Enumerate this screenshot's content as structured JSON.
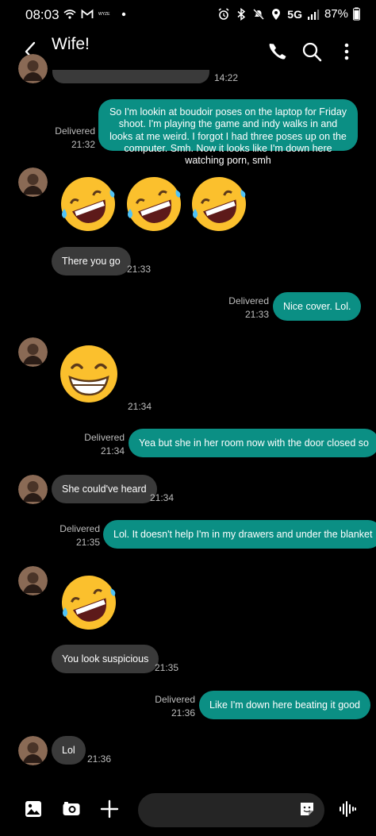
{
  "status_bar": {
    "time": "08:03",
    "network": "5G",
    "battery": "87%",
    "left_icons": [
      "wifi-calling-icon",
      "gmail-icon",
      "wyze-icon",
      "dot-icon"
    ],
    "wyze_label": "WYZE",
    "right_icons": [
      "alarm-icon",
      "bluetooth-icon",
      "mute-icon",
      "location-icon",
      "signal-icon",
      "battery-icon"
    ]
  },
  "header": {
    "title": "Wife!",
    "actions": [
      "phone-icon",
      "search-icon",
      "more-icon"
    ]
  },
  "messages": [
    {
      "id": "m0",
      "dir": "in",
      "text": "",
      "time": "14:22",
      "partial": true
    },
    {
      "id": "m1",
      "dir": "out",
      "text": "So I'm lookin at boudoir poses on the laptop for Friday shoot. I'm playing the game and indy walks in and looks at me weird. I forgot I had three poses up on the computer. Smh. Now it looks like I'm down here watching porn,  smh",
      "status": "Delivered",
      "time": "21:32"
    },
    {
      "id": "m2",
      "dir": "in",
      "emoji": [
        "🤣",
        "🤣",
        "🤣"
      ],
      "emoji_name": "rolling-on-floor-laughing"
    },
    {
      "id": "m3",
      "dir": "in",
      "text": "There you go",
      "time": "21:33"
    },
    {
      "id": "m4",
      "dir": "out",
      "text": "Nice cover. Lol.",
      "status": "Delivered",
      "time": "21:33"
    },
    {
      "id": "m5",
      "dir": "in",
      "emoji": [
        "😁"
      ],
      "emoji_name": "beaming-face",
      "time": "21:34"
    },
    {
      "id": "m6",
      "dir": "out",
      "text": "Yea but she in her room now with the door closed so",
      "status": "Delivered",
      "time": "21:34"
    },
    {
      "id": "m7",
      "dir": "in",
      "text": "She could've heard",
      "time": "21:34"
    },
    {
      "id": "m8",
      "dir": "out",
      "text": "Lol. It doesn't help I'm in my drawers and under the blanket",
      "status": "Delivered",
      "time": "21:35"
    },
    {
      "id": "m9",
      "dir": "in",
      "emoji": [
        "🤣"
      ],
      "emoji_name": "rolling-on-floor-laughing"
    },
    {
      "id": "m10",
      "dir": "in",
      "text": "You look suspicious",
      "time": "21:35"
    },
    {
      "id": "m11",
      "dir": "out",
      "text": "Like I'm down here beating it good",
      "status": "Delivered",
      "time": "21:36"
    },
    {
      "id": "m12",
      "dir": "in",
      "text": "Lol",
      "time": "21:36"
    }
  ],
  "composer": {
    "value": "",
    "placeholder": "",
    "icons": [
      "gallery-icon",
      "camera-icon",
      "plus-icon",
      "sticker-icon",
      "voice-icon"
    ]
  },
  "colors": {
    "background": "#000000",
    "incoming_bubble": "#3a3a3a",
    "outgoing_bubble": "#0b8f84",
    "meta_text": "#bdbdbd"
  }
}
